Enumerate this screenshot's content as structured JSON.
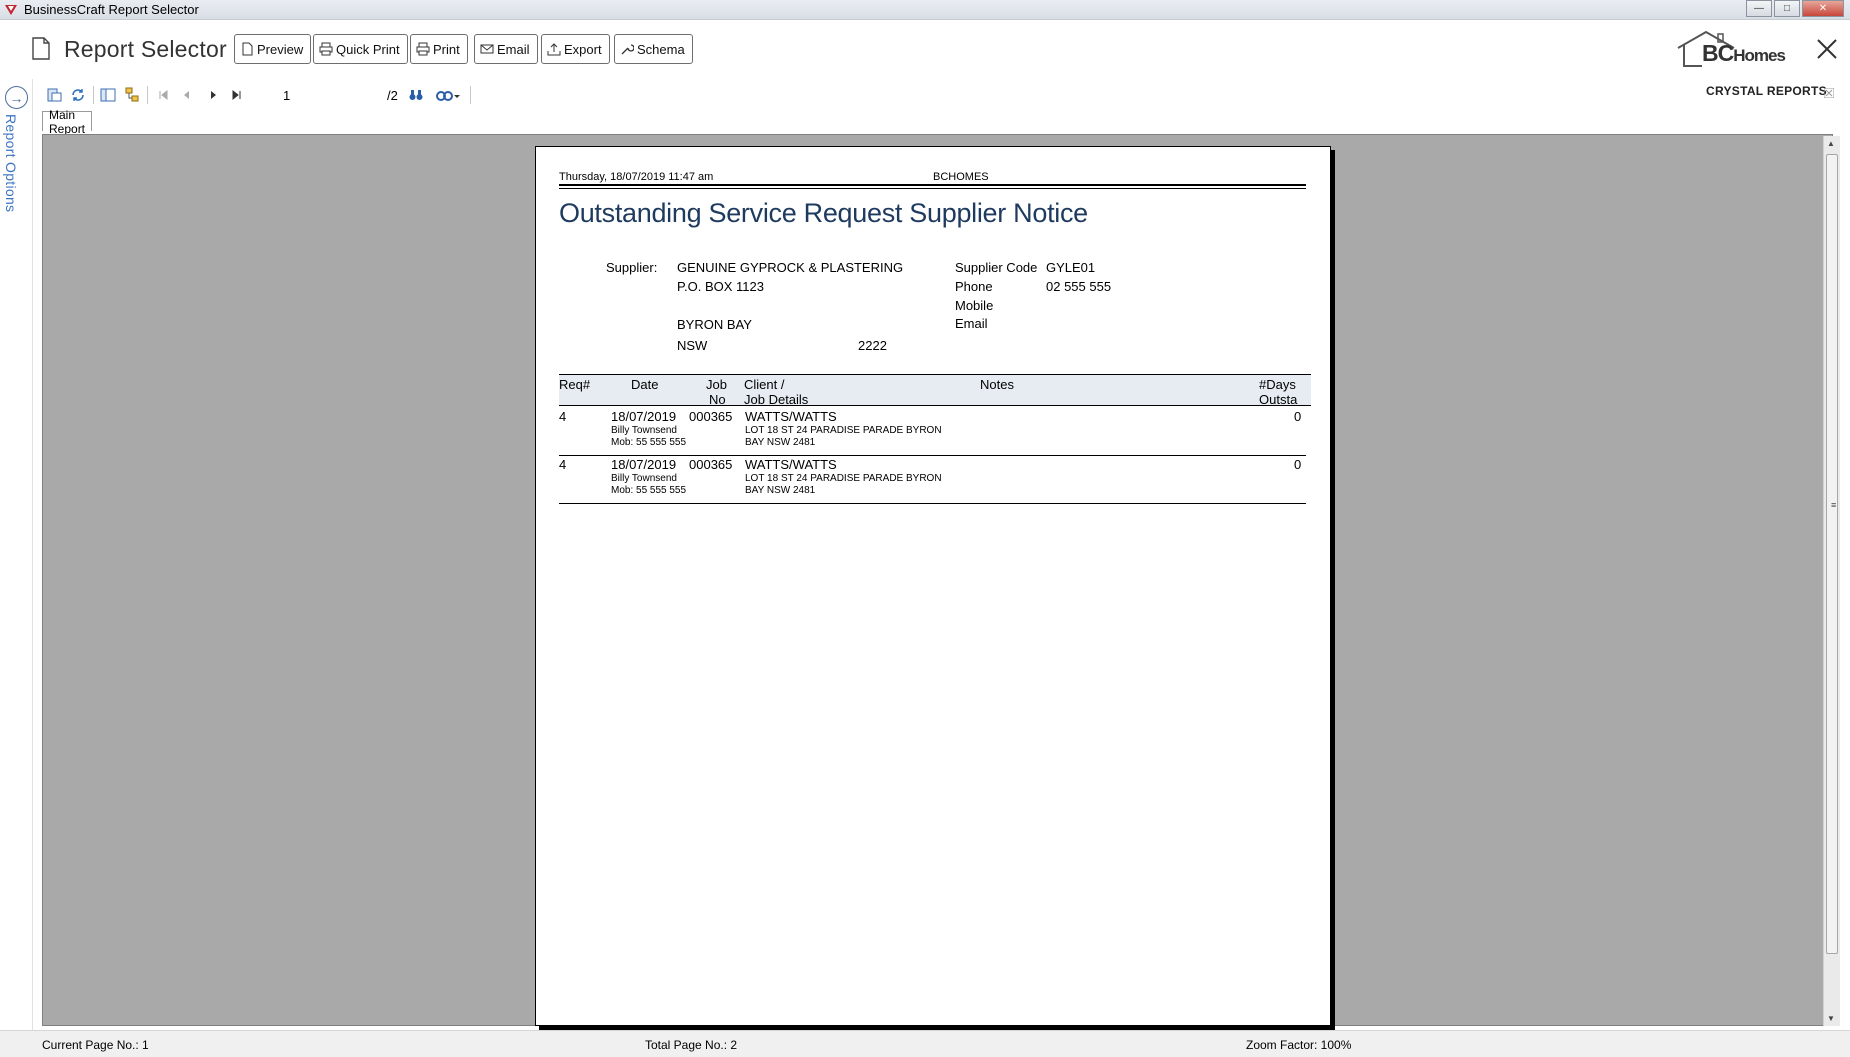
{
  "window": {
    "title": "BusinessCraft Report Selector"
  },
  "header": {
    "title": "Report Selector",
    "buttons": [
      {
        "id": "preview",
        "label": "Preview",
        "icon": "document-icon"
      },
      {
        "id": "quick-print",
        "label": "Quick Print",
        "icon": "printer-icon"
      },
      {
        "id": "print",
        "label": "Print",
        "icon": "printer-icon"
      },
      {
        "id": "email",
        "label": "Email",
        "icon": "envelope-icon"
      },
      {
        "id": "export",
        "label": "Export",
        "icon": "export-icon"
      },
      {
        "id": "schema",
        "label": "Schema",
        "icon": "wrench-icon"
      }
    ],
    "logo": {
      "bc": "BC",
      "homes": "Homes"
    }
  },
  "sidebar": {
    "label": "Report Options"
  },
  "viewer_toolbar": {
    "page_value": "1",
    "page_total": "/2",
    "brand": "CRYSTAL REPORTS"
  },
  "tabs": [
    {
      "label": "Main Report"
    }
  ],
  "report": {
    "printed": "Thursday, 18/07/2019 11:47 am",
    "company": "BCHOMES",
    "title": "Outstanding Service Request Supplier Notice",
    "supplier_label": "Supplier:",
    "supplier_name": "GENUINE GYPROCK & PLASTERING",
    "address1": "P.O. BOX 1123",
    "city": "BYRON BAY",
    "state": "NSW",
    "postcode": "2222",
    "supplier_code_label": "Supplier Code",
    "supplier_code": "GYLE01",
    "phone_label": "Phone",
    "phone": "02 555 555",
    "mobile_label": "Mobile",
    "email_label": "Email",
    "columns": {
      "req": "Req#",
      "date": "Date",
      "job1": "Job",
      "job2": "No",
      "client1": "Client /",
      "client2": "Job Details",
      "notes": "Notes",
      "days1": "#Days",
      "days2": "Outsta"
    },
    "rows": [
      {
        "req": "4",
        "date": "18/07/2019",
        "job": "000365",
        "client": "WATTS/WATTS",
        "contact": "Billy Townsend",
        "mobile": "Mob: 55 555 555",
        "details1": "LOT 18 ST 24 PARADISE PARADE BYRON",
        "details2": "BAY NSW  2481",
        "days": "0"
      },
      {
        "req": "4",
        "date": "18/07/2019",
        "job": "000365",
        "client": "WATTS/WATTS",
        "contact": "Billy Townsend",
        "mobile": "Mob: 55 555 555",
        "details1": "LOT 18 ST 24 PARADISE PARADE BYRON",
        "details2": "BAY NSW  2481",
        "days": "0"
      }
    ]
  },
  "status": {
    "current_page": "Current Page No.: 1",
    "total_pages": "Total Page No.: 2",
    "zoom": "Zoom Factor: 100%"
  }
}
